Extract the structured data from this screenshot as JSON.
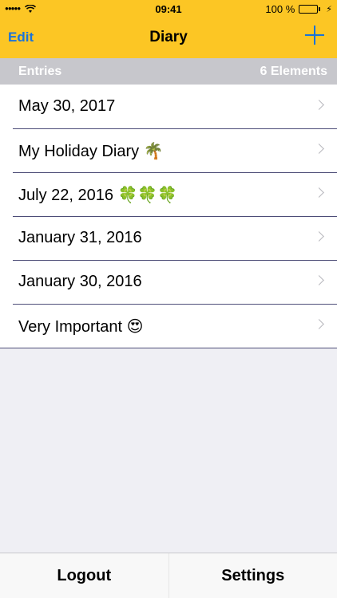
{
  "status_bar": {
    "signal": "●●●●●",
    "wifi_icon": "wifi-icon",
    "time": "09:41",
    "battery_text": "100 %",
    "battery_icon": "battery-icon",
    "charging_icon": "bolt-icon",
    "charging_symbol": "⚡"
  },
  "nav": {
    "edit_label": "Edit",
    "title": "Diary",
    "add_icon": "plus-icon"
  },
  "section": {
    "title": "Entries",
    "count": "6 Elements"
  },
  "entries": [
    {
      "label": "May 30, 2017"
    },
    {
      "label": "My Holiday Diary 🌴"
    },
    {
      "label": "July 22, 2016 🍀🍀🍀"
    },
    {
      "label": "January 31, 2016"
    },
    {
      "label": "January 30, 2016"
    },
    {
      "label": "Very Important 😍"
    }
  ],
  "tab_bar": {
    "logout_label": "Logout",
    "settings_label": "Settings"
  },
  "colors": {
    "bar": "#fcc624",
    "accent": "#1a73d9",
    "section": "#c7c7cc",
    "background": "#efeff4"
  }
}
